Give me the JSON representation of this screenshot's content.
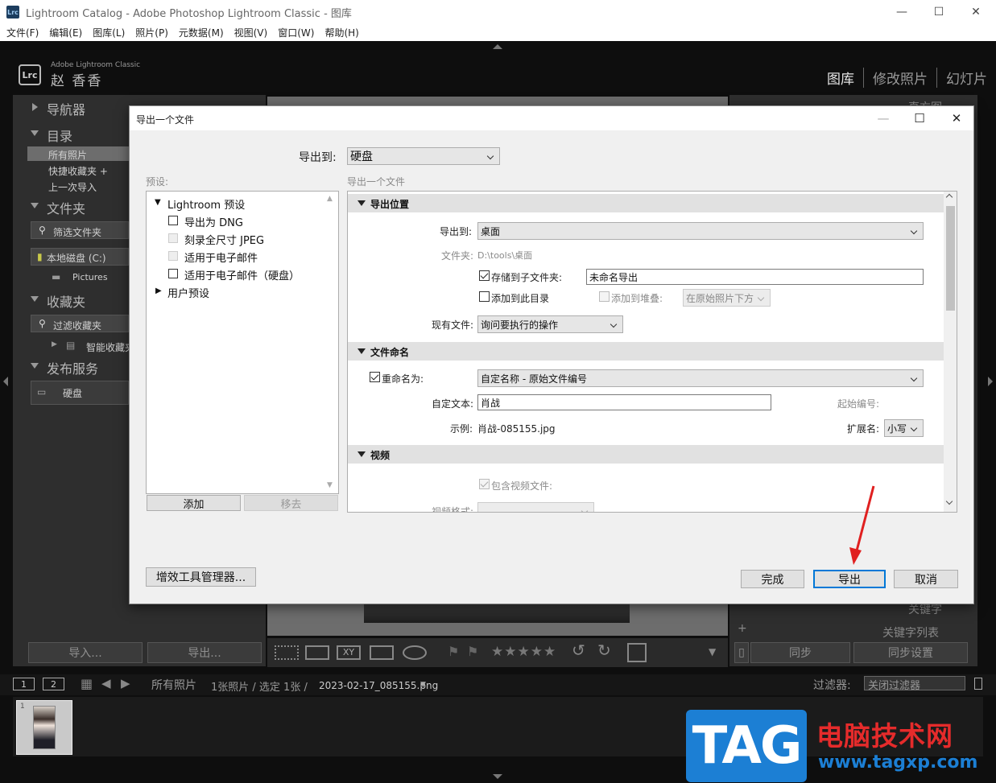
{
  "window": {
    "title": "Lightroom Catalog - Adobe Photoshop Lightroom Classic - 图库",
    "icon_text": "Lrc",
    "minimize": "—",
    "maximize": "☐",
    "close": "✕"
  },
  "menu": [
    "文件(F)",
    "编辑(E)",
    "图库(L)",
    "照片(P)",
    "元数据(M)",
    "视图(V)",
    "窗口(W)",
    "帮助(H)"
  ],
  "identity": {
    "logo": "Lrc",
    "brand": "Adobe Lightroom Classic",
    "user": "赵 香香"
  },
  "modules": [
    "图库",
    "修改照片",
    "幻灯片"
  ],
  "left_panel": {
    "navigator": "导航器",
    "catalog": "目录",
    "catalog_items": [
      "所有照片",
      "快捷收藏夹 +",
      "上一次导入"
    ],
    "folders": "文件夹",
    "filter_folders": "筛选文件夹",
    "local_disk": "本地磁盘 (C:)",
    "pictures": "Pictures",
    "collections": "收藏夹",
    "filter_collections": "过滤收藏夹",
    "smart_collections": "智能收藏夹",
    "publish_services": "发布服务",
    "hard_drive": "硬盘",
    "import_btn": "导入...",
    "export_btn": "导出..."
  },
  "right_panel": {
    "histogram": "直方图",
    "keywords": "关键字",
    "keyword_list": "关键字列表",
    "sync": "同步",
    "sync_settings": "同步设置"
  },
  "filmstrip_bar": {
    "page1": "1",
    "page2": "2",
    "source": "所有照片",
    "count": "1张照片 / 选定 1张 /",
    "filename": "2023-02-17_085155.png",
    "filter_label": "过滤器:",
    "filter_value": "关闭过滤器",
    "thumb_index": "1"
  },
  "watermark": {
    "tag": "TAG",
    "cn": "电脑技术网",
    "url": "www.tagxp.com"
  },
  "dialog": {
    "title": "导出一个文件",
    "export_to_label": "导出到:",
    "export_to_value": "硬盘",
    "presets_label": "预设:",
    "settings_label": "导出一个文件",
    "presets": {
      "group_lightroom": "Lightroom 预设",
      "items": [
        "导出为 DNG",
        "刻录全尺寸 JPEG",
        "适用于电子邮件",
        "适用于电子邮件（硬盘）"
      ],
      "group_user": "用户预设"
    },
    "add_btn": "添加",
    "remove_btn": "移去",
    "plugin_manager_btn": "增效工具管理器...",
    "done_btn": "完成",
    "export_btn": "导出",
    "cancel_btn": "取消",
    "location": {
      "header": "导出位置",
      "export_to_label": "导出到:",
      "export_to_value": "桌面",
      "folder_label": "文件夹:",
      "folder_value": "D:\\tools\\桌面",
      "subfolder_label": "存储到子文件夹:",
      "subfolder_value": "未命名导出",
      "add_catalog_label": "添加到此目录",
      "add_stack_label": "添加到堆叠:",
      "stack_value": "在原始照片下方",
      "existing_label": "现有文件:",
      "existing_value": "询问要执行的操作"
    },
    "naming": {
      "header": "文件命名",
      "rename_label": "重命名为:",
      "rename_value": "自定名称 - 原始文件编号",
      "custom_text_label": "自定文本:",
      "custom_text_value": "肖战",
      "start_number_label": "起始编号:",
      "example_label": "示例:",
      "example_value": "肖战-085155.jpg",
      "extension_label": "扩展名:",
      "extension_value": "小写"
    },
    "video": {
      "header": "视频",
      "include_label": "包含视频文件:",
      "format_label": "视频格式:"
    }
  },
  "colors": {
    "accent_focus": "#0078d7",
    "annotation_arrow": "#e02020",
    "watermark_blue": "#1c7fd4",
    "watermark_red": "#e52b2b"
  }
}
